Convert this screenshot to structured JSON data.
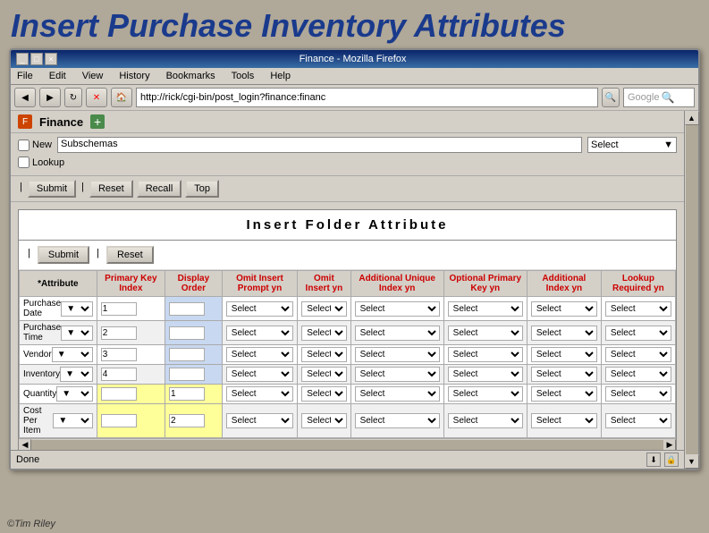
{
  "title": "Insert Purchase Inventory Attributes",
  "browser": {
    "titlebar": "Finance - Mozilla Firefox",
    "menu_items": [
      "File",
      "Edit",
      "View",
      "History",
      "Bookmarks",
      "Tools",
      "Help"
    ],
    "address": "http://rick/cgi-bin/post_login?finance:financ",
    "search_placeholder": "Google",
    "win_btns": [
      "_",
      "□",
      "×"
    ]
  },
  "finance": {
    "title": "Finance",
    "checkbox_new": "New",
    "checkbox_lookup": "Lookup",
    "subschemas_label": "Subschemas",
    "select_label": "Select",
    "buttons": [
      "Submit",
      "Reset",
      "Recall",
      "Top"
    ]
  },
  "folder": {
    "title": "Insert Folder Attribute",
    "submit_btn": "Submit",
    "reset_btn": "Reset"
  },
  "table": {
    "headers": [
      "*Attribute",
      "Primary Key Index",
      "Display Order",
      "Omit Insert Prompt yn",
      "Omit Insert yn",
      "Additional Unique Index yn",
      "Optional Primary Key yn",
      "Additional Index yn",
      "Lookup Required yn"
    ],
    "rows": [
      {
        "name": "Purchase Date",
        "key_index": "1",
        "display_order": "",
        "highlight_display": "lightblue",
        "highlight_key": "",
        "selects": [
          "Select",
          "Select",
          "Select",
          "Select",
          "Select",
          "Select"
        ]
      },
      {
        "name": "Purchase Time",
        "key_index": "2",
        "display_order": "",
        "highlight_display": "lightblue",
        "highlight_key": "",
        "selects": [
          "Select",
          "Select",
          "Select",
          "Select",
          "Select",
          "Select"
        ]
      },
      {
        "name": "Vendor",
        "key_index": "3",
        "display_order": "",
        "highlight_display": "lightblue",
        "highlight_key": "",
        "selects": [
          "Select",
          "Select",
          "Select",
          "Select",
          "Select",
          "Select"
        ]
      },
      {
        "name": "Inventory",
        "key_index": "4",
        "display_order": "",
        "highlight_display": "lightblue",
        "highlight_key": "",
        "selects": [
          "Select",
          "Select",
          "Select",
          "Select",
          "Select",
          "Select"
        ]
      },
      {
        "name": "Quantity",
        "key_index": "",
        "display_order": "1",
        "highlight_display": "yellow",
        "highlight_key": "yellow",
        "selects": [
          "Select",
          "Select",
          "Select",
          "Select",
          "Select",
          "Select"
        ]
      },
      {
        "name": "Cost Per Item",
        "key_index": "",
        "display_order": "2",
        "highlight_display": "yellow",
        "highlight_key": "yellow",
        "selects": [
          "Select",
          "Select",
          "Select",
          "Select",
          "Select",
          "Select"
        ]
      }
    ]
  },
  "status": {
    "text": "Done"
  },
  "copyright": "©Tim Riley"
}
